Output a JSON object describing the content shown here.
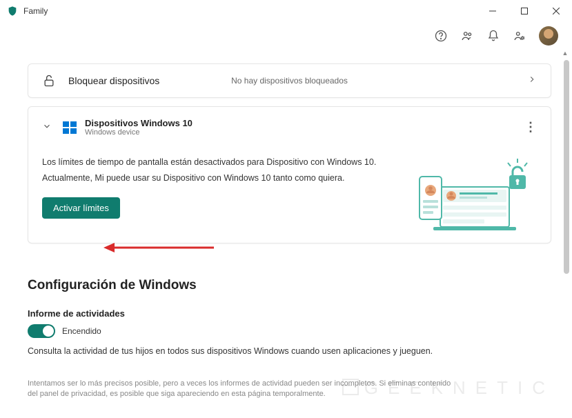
{
  "window": {
    "title": "Family"
  },
  "block_devices": {
    "label": "Bloquear dispositivos",
    "status": "No hay dispositivos bloqueados"
  },
  "device": {
    "name": "Dispositivos Windows 10",
    "subtitle": "Windows device",
    "message_line1": "Los límites de tiempo de pantalla están desactivados para Dispositivo con Windows 10.",
    "message_line2": "Actualmente, Mi puede usar su Dispositivo con Windows 10 tanto como quiera.",
    "activate_button": "Activar límites"
  },
  "settings": {
    "section_title": "Configuración de Windows",
    "activity_report": {
      "label": "Informe de actividades",
      "state": "Encendido",
      "description": "Consulta la actividad de tus hijos en todos sus dispositivos Windows cuando usen aplicaciones y jueguen."
    },
    "disclaimer": "Intentamos ser lo más precisos posible, pero a veces los informes de actividad pueden ser incompletos. Si eliminas contenido del panel de privacidad, es posible que siga apareciendo en esta página temporalmente."
  },
  "watermark": "GEEKNETIC",
  "colors": {
    "accent": "#107C6E",
    "brand_blue": "#0078D4"
  }
}
